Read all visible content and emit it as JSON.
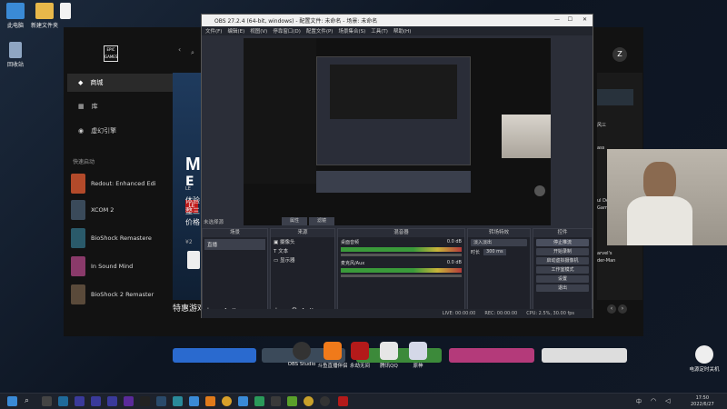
{
  "desktop": {
    "icons": [
      {
        "label": "此电脑"
      },
      {
        "label": "新建文件夹"
      },
      {
        "label": "回收站"
      }
    ]
  },
  "epic": {
    "logo": "EPIC GAMES",
    "nav": [
      {
        "label": "商城"
      },
      {
        "label": "库"
      },
      {
        "label": "虚幻引擎"
      }
    ],
    "quick_launch_label": "快速启动",
    "games": [
      {
        "label": "Redout: Enhanced Edi"
      },
      {
        "label": "XCOM 2"
      },
      {
        "label": "BioShock Remastere"
      },
      {
        "label": "In Sound Mind"
      },
      {
        "label": "BioShock 2 Remaster"
      }
    ],
    "featured": {
      "title": "M",
      "subtitle": "E",
      "tag": "LE",
      "line1": "体验",
      "line2": "整三",
      "line3": "价格",
      "price": "¥2"
    },
    "specials_label": "特惠游戏",
    "right_text": [
      "风三",
      "ass",
      "ul Dead",
      "Game",
      "arvel's",
      "der-Man"
    ]
  },
  "obs": {
    "title": "OBS 27.2.4 (64-bit, windows) - 配置文件: 未命名 - 场景: 未命名",
    "menu": [
      "文件(F)",
      "编辑(E)",
      "视图(V)",
      "停靠窗口(D)",
      "配置文件(P)",
      "场景集合(S)",
      "工具(T)",
      "帮助(H)"
    ],
    "no_source": "未选择源",
    "props_label": "属性",
    "filters_label": "滤镜",
    "docks": {
      "scenes": "场景",
      "sources": "来源",
      "mixer": "混音器",
      "transitions": "转场特效",
      "controls": "控件"
    },
    "scene_item": "直播",
    "sources": [
      "摄像头",
      "文本",
      "显示器"
    ],
    "mixer": [
      {
        "name": "桌面音频",
        "db": "0.0 dB"
      },
      {
        "name": "麦克风/Aux",
        "db": "0.0 dB"
      }
    ],
    "transition": {
      "value": "淡入淡出",
      "duration_label": "时长",
      "duration": "300 ms"
    },
    "controls": [
      "停止推流",
      "开始录制",
      "启动虚拟摄像机",
      "工作室模式",
      "设置",
      "退出"
    ],
    "status": {
      "live": "LIVE: 00:00:00",
      "rec": "REC: 00:00:00",
      "cpu": "CPU: 2.5%, 30.00 fps"
    }
  },
  "dock_apps": [
    {
      "label": "OBS Studio"
    },
    {
      "label": "斗鱼直播伴侣"
    },
    {
      "label": "永劫无间"
    },
    {
      "label": "腾讯QQ"
    },
    {
      "label": "原神"
    }
  ],
  "shutdown": {
    "label": "电源定时关机"
  },
  "taskbar": {
    "lang": "中",
    "time": "17:50",
    "date": "2022/6/27"
  },
  "colors": {
    "accent": "#4a90e2",
    "obs_bg": "#2b2e38",
    "epic_bg": "#121212"
  }
}
